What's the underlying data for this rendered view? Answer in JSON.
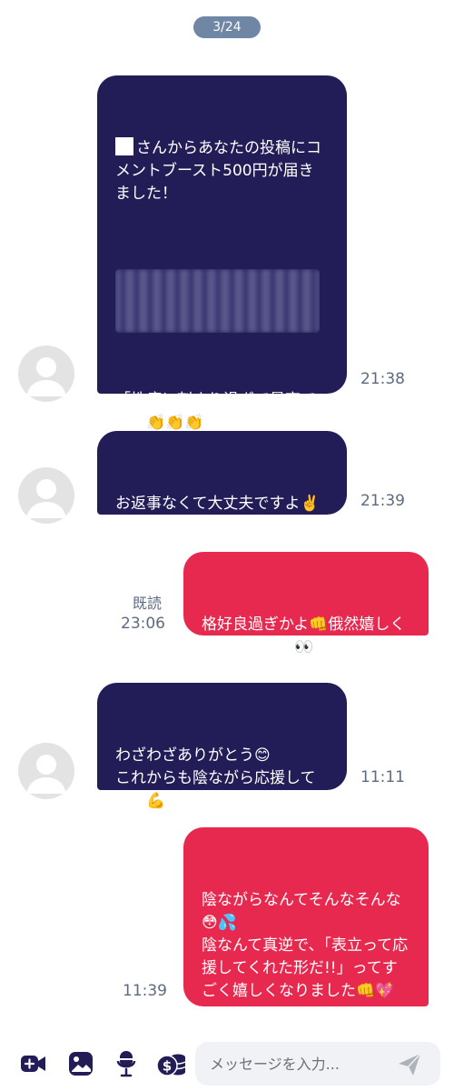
{
  "page_indicator": "3/24",
  "messages": [
    {
      "direction": "in",
      "text_head": "さんからあなたの投稿にコメントブースト500円が届きました！",
      "text_body": "「性癖に刺さり過ぎて最高でした👏👏👏\nこれからも楽しみにしてます😁」",
      "time": "21:38"
    },
    {
      "direction": "in",
      "text": "お返事なくて大丈夫ですよ✌️",
      "time": "21:39"
    },
    {
      "direction": "out",
      "text": "格好良過ぎかよ👊俄然嬉しくなっちゃうし👀♡",
      "read": "既読",
      "time": "23:06"
    },
    {
      "direction": "in",
      "text": "わざわざありがとう😊\nこれからも陰ながら応援してます💪",
      "time": "11:11"
    },
    {
      "direction": "out",
      "text": "陰ながらなんてそんなそんな😳💦\n陰なんて真逆で、「表立って応援してくれた形だ!!」ってすごく嬉しくなりました👊💖",
      "time": "11:39"
    }
  ],
  "input_bar": {
    "placeholder": "メッセージを入力...",
    "icons": [
      "video-icon",
      "image-icon",
      "microphone-icon",
      "money-icon",
      "send-icon"
    ]
  },
  "colors": {
    "incoming_bubble": "#221c57",
    "outgoing_bubble": "#e8294f",
    "page_indicator": "#6f86a4",
    "timestamp": "#5d6b80"
  }
}
